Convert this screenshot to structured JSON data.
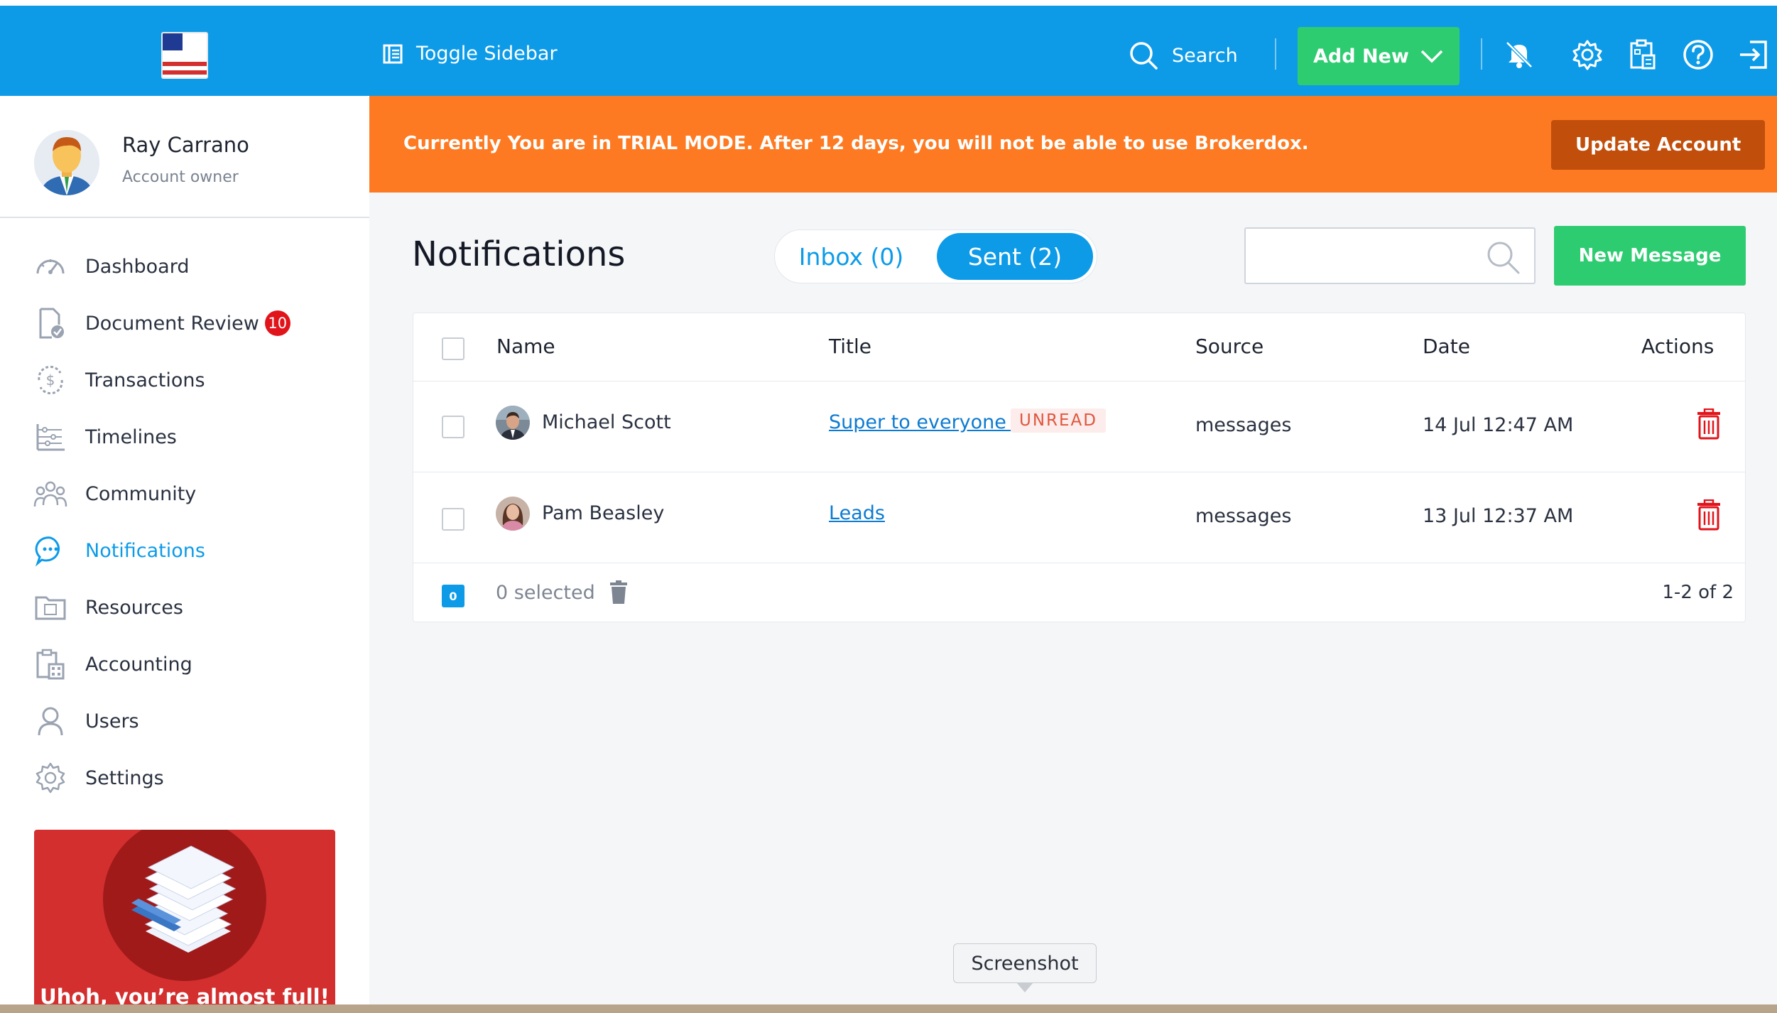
{
  "header": {
    "toggle_label": "Toggle Sidebar",
    "search_label": "Search",
    "add_new_label": "Add New",
    "icons": [
      "bell-off-icon",
      "gear-icon",
      "calculator-icon",
      "help-icon",
      "logout-icon"
    ]
  },
  "user": {
    "name": "Ray Carrano",
    "role": "Account owner"
  },
  "sidebar": {
    "items": [
      {
        "label": "Dashboard",
        "icon": "speedometer-icon"
      },
      {
        "label": "Document Review",
        "icon": "document-check-icon",
        "badge": "10"
      },
      {
        "label": "Transactions",
        "icon": "dollar-cycle-icon"
      },
      {
        "label": "Timelines",
        "icon": "timeline-icon"
      },
      {
        "label": "Community",
        "icon": "people-icon"
      },
      {
        "label": "Notifications",
        "icon": "chat-bubble-icon",
        "active": true
      },
      {
        "label": "Resources",
        "icon": "folder-icon"
      },
      {
        "label": "Accounting",
        "icon": "calculator-doc-icon"
      },
      {
        "label": "Users",
        "icon": "user-icon"
      },
      {
        "label": "Settings",
        "icon": "gear-icon"
      }
    ],
    "promo_text": "Uhoh, you’re almost full!"
  },
  "trial": {
    "message": "Currently You are in TRIAL MODE. After 12 days, you will not be able to use Brokerdox.",
    "button": "Update Account"
  },
  "page": {
    "title": "Notifications",
    "tab_inbox": "Inbox (0)",
    "tab_sent": "Sent (2)",
    "new_message": "New Message"
  },
  "table": {
    "columns": {
      "name": "Name",
      "title": "Title",
      "source": "Source",
      "date": "Date",
      "actions": "Actions"
    },
    "rows": [
      {
        "name": "Michael Scott",
        "title": "Super to everyone ",
        "badge": "UNREAD",
        "source": "messages",
        "date": "14 Jul 12:47 AM"
      },
      {
        "name": "Pam Beasley",
        "title": "Leads",
        "badge": "",
        "source": "messages",
        "date": "13 Jul 12:37 AM"
      }
    ],
    "selected_count": "0",
    "selected_text": "0 selected",
    "pagination": "1-2 of 2"
  },
  "tooltip": "Screenshot",
  "colors": {
    "header": "#0d9be8",
    "trial_banner": "#fd7a22",
    "update_button": "#c14e0b",
    "green_button": "#2ecc71",
    "badge_red": "#e1141b",
    "delete_red": "#e1141b"
  }
}
